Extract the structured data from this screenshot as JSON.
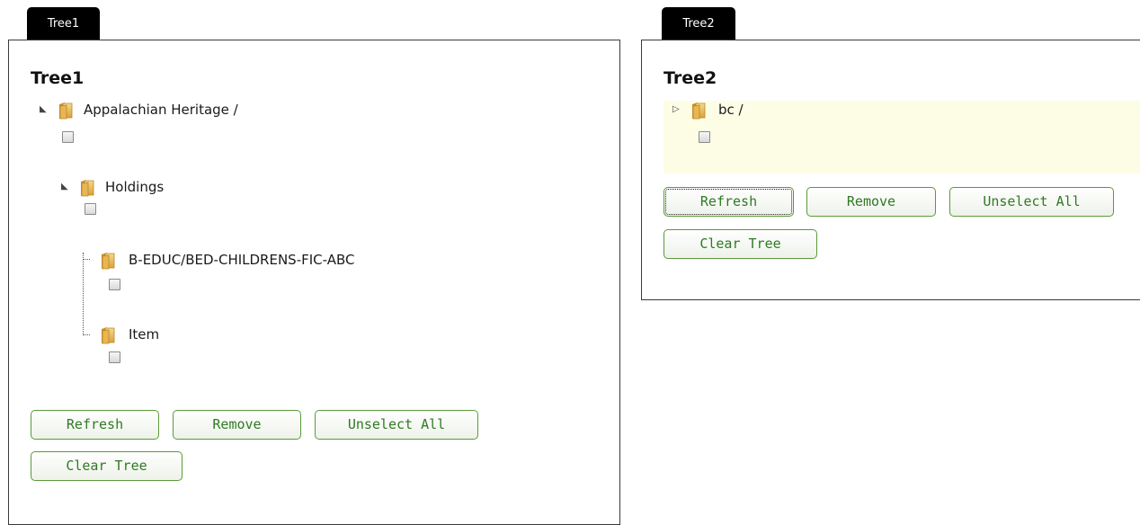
{
  "tree1": {
    "tab_label": "Tree1",
    "title": "Tree1",
    "nodes": {
      "root": {
        "label": "Appalachian Heritage /",
        "icon": "folder-icon"
      },
      "holdings": {
        "label": "Holdings",
        "icon": "folder-icon"
      },
      "educ": {
        "label": "B-EDUC/BED-CHILDRENS-FIC-ABC",
        "icon": "folder-icon"
      },
      "item": {
        "label": "Item",
        "icon": "folder-icon"
      }
    },
    "buttons": {
      "refresh": "Refresh",
      "remove": "Remove",
      "unselect_all": "Unselect All",
      "clear_tree": "Clear Tree"
    }
  },
  "tree2": {
    "tab_label": "Tree2",
    "title": "Tree2",
    "nodes": {
      "root": {
        "label": "bc /",
        "icon": "folder-icon"
      }
    },
    "buttons": {
      "refresh": "Refresh",
      "remove": "Remove",
      "unselect_all": "Unselect All",
      "clear_tree": "Clear Tree"
    }
  },
  "colors": {
    "button_text": "#2f7a22",
    "button_border": "#5a9a3a",
    "tab_bg": "#000000",
    "selection_highlight": "#fdfde6",
    "folder": "#e8b84a"
  }
}
